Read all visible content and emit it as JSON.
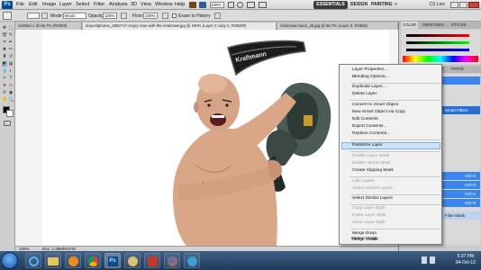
{
  "menubar": {
    "logo": "Ps",
    "items": [
      "File",
      "Edit",
      "Image",
      "Layer",
      "Select",
      "Filter",
      "Analysis",
      "3D",
      "View",
      "Window",
      "Help"
    ],
    "workspace": [
      "ESSENTIALS",
      "DESIGN",
      "PAINTING"
    ],
    "more": "»",
    "cslive": "CS Live"
  },
  "options": {
    "mode_label": "Mode:",
    "mode_value": "Brush",
    "opacity_label": "Opacity:",
    "opacity_value": "100%",
    "flow_label": "Flow:",
    "flow_value": "100%",
    "erase_history": "Erase to History"
  },
  "tabs": [
    "Untitled-1 @ 66.7% (RGB/8)",
    "depositphotos_4892717-Angry-man-with-the-chainsaw.jpg @ 100% (Layer 2 copy 2, RGB/8#)",
    "chainsaw-man1_45.jpg @ 66.7% (Layer 0, RGB/8)"
  ],
  "statusbar": {
    "zoom": "100%",
    "doc": "Doc: 2.29M/9.07M"
  },
  "panels": {
    "top_tabs": [
      "COLOR",
      "SWATCHES",
      "STYLES"
    ],
    "layers_tabs": [
      "LAYERS",
      "CHANNELS",
      "PATHS"
    ],
    "layer_rows": [
      "Ctrl+2",
      "Ctrl+3",
      "Ctrl+4",
      "Ctrl+5"
    ],
    "filter_label": "Smart Filters",
    "filter_mask": "Filter Mask"
  },
  "context_menu": {
    "groups": [
      [
        "Layer Properties...",
        "Blending Options..."
      ],
      [
        "Duplicate Layer...",
        "Delete Layer"
      ],
      [
        "Convert to Smart Object",
        "New Smart Object via Copy",
        "Edit Contents",
        "Export Contents...",
        "Replace Contents..."
      ],
      [
        "Rasterize Layer"
      ],
      [
        "Enable Layer Mask",
        "Enable Vector Mask",
        "Create Clipping Mask"
      ],
      [
        "Link Layers",
        "Select Linked Layers"
      ],
      [
        "Select Similar Layers"
      ],
      [
        "Copy Layer Style",
        "Paste Layer Style",
        "Clear Layer Style"
      ],
      [
        "Merge Down",
        "Merge Visible",
        "Flatten Image"
      ]
    ],
    "highlighted": "Rasterize Layer",
    "disabled": [
      "Enable Layer Mask",
      "Enable Vector Mask",
      "Link Layers",
      "Select Linked Layers",
      "Copy Layer Style",
      "Paste Layer Style",
      "Clear Layer Style"
    ]
  },
  "chainsaw_brand": "Kraftmann",
  "taskbar": {
    "time": "5:37 PM",
    "date": "04-Oct-12"
  },
  "colors": {
    "accent": "#2a6fd6",
    "highlight": "#cde3f7",
    "taskbar": "#2b4a6f"
  }
}
